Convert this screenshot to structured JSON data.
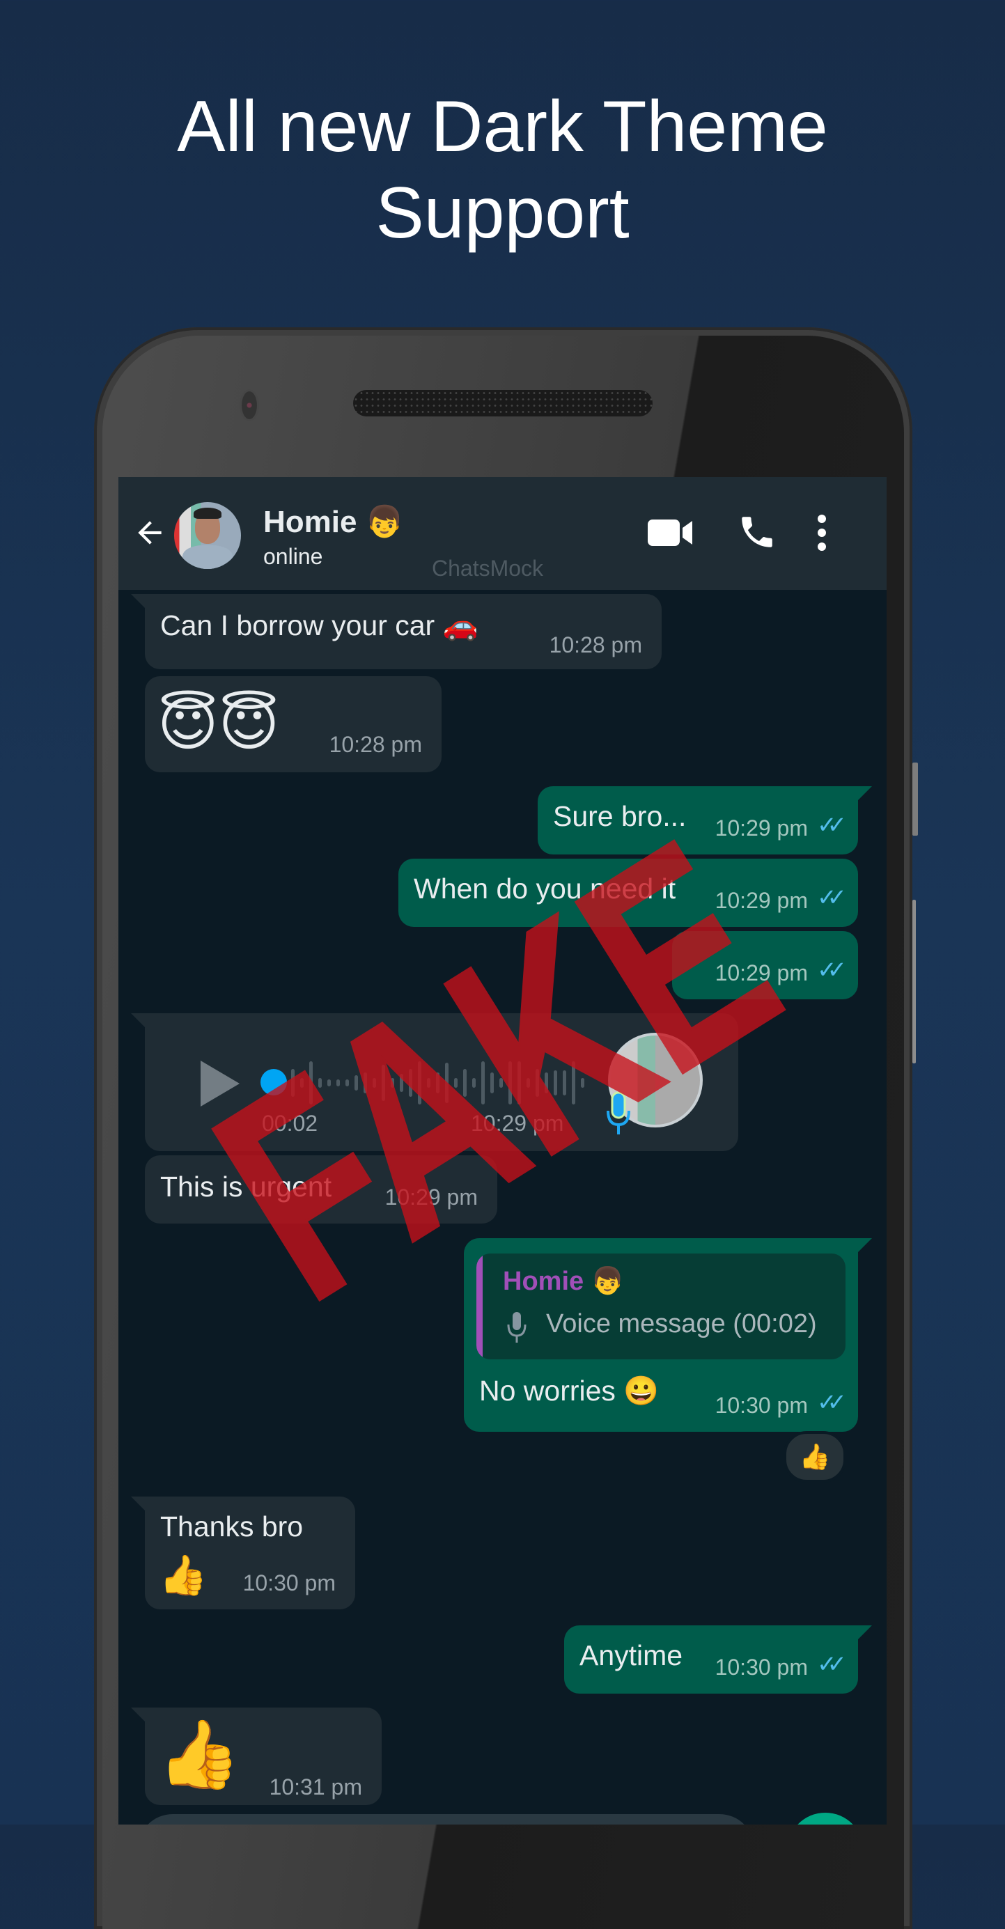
{
  "headline": {
    "line1": "All new Dark Theme",
    "line2": "Support"
  },
  "header": {
    "contact_name": "Homie 👦",
    "status": "online",
    "watermark": "ChatsMock",
    "icons": [
      "back-arrow-icon",
      "video-call-icon",
      "voice-call-icon",
      "more-options-icon"
    ]
  },
  "messages": [
    {
      "direction": "in",
      "text": "Can I borrow your car 🚗",
      "time": "10:28 pm"
    },
    {
      "direction": "in",
      "text": "😇😇",
      "time": "10:28 pm"
    },
    {
      "direction": "out",
      "text": "Sure bro...",
      "time": "10:29 pm",
      "status": "read"
    },
    {
      "direction": "out",
      "text": "When do you need it",
      "time": "10:29 pm",
      "status": "read"
    },
    {
      "direction": "out",
      "text": "",
      "time": "10:29 pm",
      "status": "read"
    },
    {
      "direction": "in",
      "type": "voice",
      "duration": "00:02",
      "time": "10:29 pm",
      "progress": 0
    },
    {
      "direction": "in",
      "text": "This is urgent",
      "time": "10:29 pm"
    },
    {
      "direction": "out",
      "text": "No worries 😀",
      "time": "10:30 pm",
      "status": "read",
      "reply_to": {
        "name": "Homie 👦",
        "text": "Voice message (00:02)"
      },
      "reaction": "👍"
    },
    {
      "direction": "in",
      "text": "Thanks bro",
      "text2": "👍",
      "time": "10:30 pm"
    },
    {
      "direction": "out",
      "text": "Anytime",
      "time": "10:30 pm",
      "status": "read"
    },
    {
      "direction": "in",
      "text": "👍",
      "time": "10:31 pm"
    }
  ],
  "overlay": {
    "stamp": "FAKE",
    "color": "#c8101a"
  },
  "colors": {
    "incoming": "#1f2c34",
    "outgoing": "#005c4b",
    "read_ticks": "#53bdeb",
    "quote_accent": "#a14fb8",
    "fab": "#00a884"
  }
}
